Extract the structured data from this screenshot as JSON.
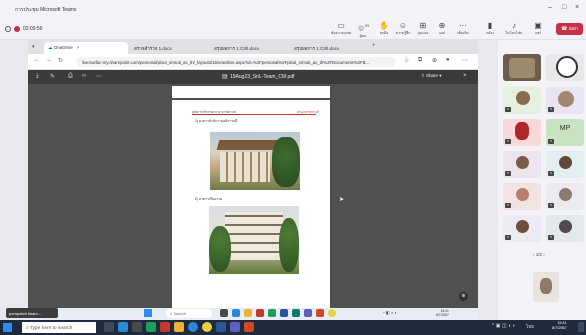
{
  "teams": {
    "window_title": "การประชุม Microsoft Teams",
    "timer": "02:09:56",
    "toolbar": [
      {
        "label": "ข้อความแชท",
        "icon": "chat-icon"
      },
      {
        "label": "ผู้คน",
        "icon": "people-icon",
        "badge": "59"
      },
      {
        "label": "ยกมือ",
        "icon": "raise-hand-icon"
      },
      {
        "label": "ความรู้สึก",
        "icon": "react-icon"
      },
      {
        "label": "มุมมอง",
        "icon": "view-icon"
      },
      {
        "label": "แอป",
        "icon": "apps-icon"
      },
      {
        "label": "เพิ่มเติม",
        "icon": "more-icon"
      },
      {
        "label": "กล้อง",
        "icon": "camera-icon"
      },
      {
        "label": "ไมโครโฟน",
        "icon": "mic-icon"
      },
      {
        "label": "แชร์",
        "icon": "share-icon"
      }
    ],
    "leave_label": "ออก",
    "pager": "1/2"
  },
  "browser": {
    "tabs": [
      {
        "label": "OneDrive",
        "active": true
      },
      {
        "label": "ตรวจสำรวจ 1.docx",
        "active": false
      },
      {
        "label": "สรุปผลการ 1.Ctrlt.docx",
        "active": false
      },
      {
        "label": "สรุปผลการ 1.Ctrlt.docx",
        "active": false
      }
    ],
    "url": "livemutfac-my.sharepoint.com/personal/pisut_srmuti_ac_th/_layouts/15/onedrive.aspx?id=%2Fpersonal%2Fpisut_srmuti_ac_th%2FDocuments%2FB..."
  },
  "pdf": {
    "file_name": "19Aug23_SnL-Team_CM.pdf",
    "share_label": "Share",
    "header_left": "คู่มือการบริหารจัดการอาคารสถานที่",
    "header_right": "ฝ่ายอาคารสถานที่",
    "caption1": "1) อาคารสำนักงานอธิการบดี",
    "caption2": "2) อาคารเรียนรวม"
  },
  "inner_taskbar": {
    "search_placeholder": "Search",
    "time": "15:41",
    "date": "8/7/2567"
  },
  "presenter_label": "pornpatch kham...",
  "gallery": {
    "mp_initials": "MP"
  },
  "host_taskbar": {
    "search_placeholder": "Type here to search",
    "time": "15:41",
    "date": "8/7/2567"
  }
}
